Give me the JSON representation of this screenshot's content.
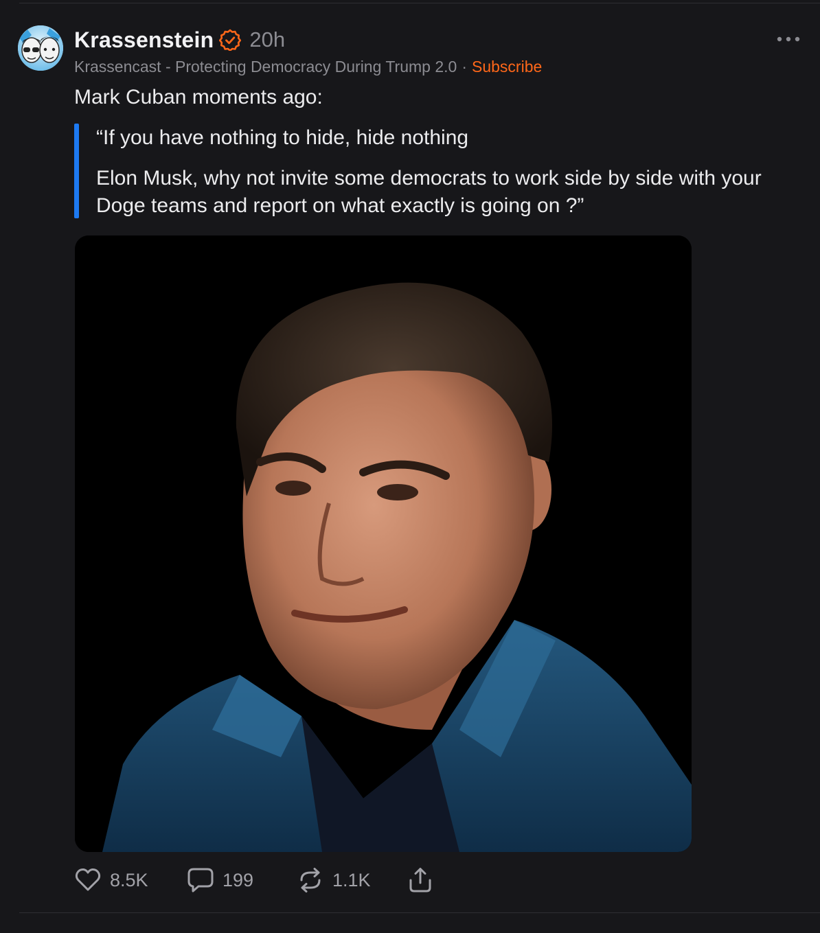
{
  "post": {
    "author": "Krassenstein",
    "verified": true,
    "time_ago": "20h",
    "publication": "Krassencast - Protecting Democracy During Trump 2.0",
    "separator": "·",
    "subscribe_label": "Subscribe",
    "text": "Mark Cuban moments ago:",
    "quote": {
      "line1": "“If you have nothing to hide, hide nothing",
      "line2": "Elon Musk, why not invite some democrats to work side by side with your Doge teams and report on what exactly is going on ?”"
    }
  },
  "actions": {
    "likes": "8.5K",
    "comments": "199",
    "restacks": "1.1K"
  },
  "icons": {
    "verified": "verified-badge-icon",
    "more": "more-dots-icon",
    "like": "heart-icon",
    "comment": "comment-bubble-icon",
    "restack": "restack-arrows-icon",
    "share": "share-upload-icon"
  },
  "colors": {
    "background": "#17171a",
    "accent_orange": "#ff6719",
    "quote_bar": "#1d7af2",
    "muted_text": "#8c8c92"
  }
}
